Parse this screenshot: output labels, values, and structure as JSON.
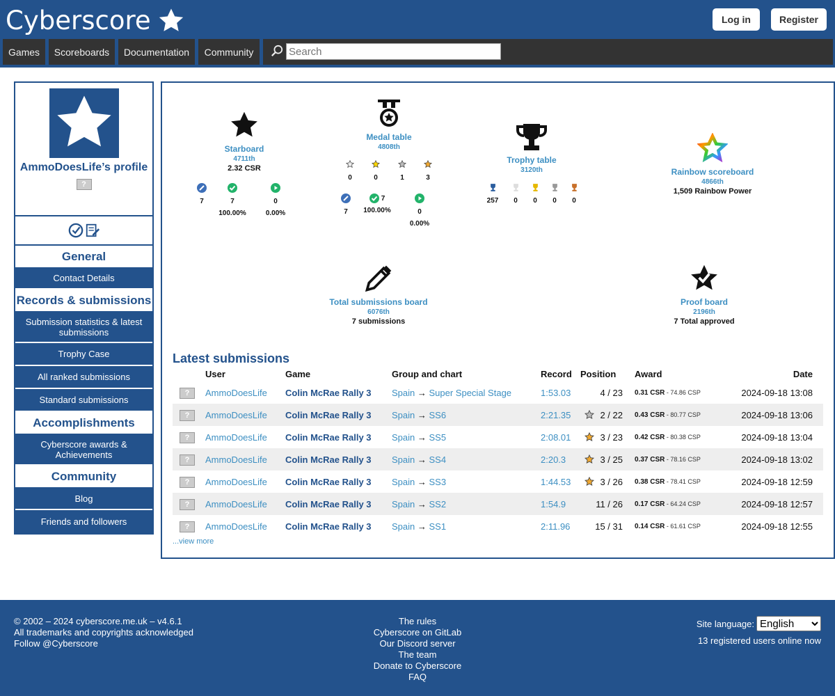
{
  "brand": {
    "name": "Cyberscore"
  },
  "header": {
    "login": "Log in",
    "register": "Register"
  },
  "nav": {
    "items": [
      "Games",
      "Scoreboards",
      "Documentation",
      "Community"
    ],
    "search_placeholder": "Search"
  },
  "sidebar": {
    "profile_name": "AmmoDoesLife’s profile",
    "badge": "?",
    "sections": [
      {
        "heading": "General",
        "links": [
          "Contact Details"
        ]
      },
      {
        "heading": "Records & submissions",
        "links": [
          "Submission statistics & latest submissions",
          "Trophy Case",
          "All ranked submissions",
          "Standard submissions"
        ]
      },
      {
        "heading": "Accomplishments",
        "links": [
          "Cyberscore awards & Achievements"
        ]
      },
      {
        "heading": "Community",
        "links": [
          "Blog",
          "Friends and followers"
        ]
      }
    ]
  },
  "boards": {
    "starboard": {
      "title": "Starboard",
      "rank": "4711th",
      "value": "2.32 CSR",
      "stats": [
        "7",
        "7",
        "0"
      ],
      "pcts": [
        "100.00%",
        "0.00%"
      ]
    },
    "medal": {
      "title": "Medal table",
      "rank": "4808th",
      "medals": [
        "0",
        "0",
        "1",
        "3"
      ],
      "stats": [
        "7",
        "7",
        "0"
      ],
      "pcts": [
        "100.00%",
        "0.00%"
      ]
    },
    "trophy": {
      "title": "Trophy table",
      "rank": "3120th",
      "values": [
        "257",
        "0",
        "0",
        "0",
        "0"
      ]
    },
    "rainbow": {
      "title": "Rainbow scoreboard",
      "rank": "4866th",
      "value": "1,509 Rainbow Power"
    },
    "total": {
      "title": "Total submissions board",
      "rank": "6076th",
      "value": "7 submissions"
    },
    "proof": {
      "title": "Proof board",
      "rank": "2196th",
      "value": "7 Total approved"
    }
  },
  "latest": {
    "heading": "Latest submissions",
    "columns": [
      "User",
      "Game",
      "Group and chart",
      "Record",
      "Position",
      "Award",
      "Date"
    ],
    "rows": [
      {
        "user": "AmmoDoesLife",
        "game": "Colin McRae Rally 3",
        "group": "Spain",
        "chart": "Super Special Stage",
        "record": "1:53.03",
        "position": "4 / 23",
        "star": "",
        "csr": "0.31 CSR",
        "csp": " - 74.86 CSP",
        "date": "2024-09-18 13:08"
      },
      {
        "user": "AmmoDoesLife",
        "game": "Colin McRae Rally 3",
        "group": "Spain",
        "chart": "SS6",
        "record": "2:21.35",
        "position": "2 / 22",
        "star": "#bbbbbb",
        "csr": "0.43 CSR",
        "csp": " - 80.77 CSP",
        "date": "2024-09-18 13:06"
      },
      {
        "user": "AmmoDoesLife",
        "game": "Colin McRae Rally 3",
        "group": "Spain",
        "chart": "SS5",
        "record": "2:08.01",
        "position": "3 / 23",
        "star": "#f0a830",
        "csr": "0.42 CSR",
        "csp": " - 80.38 CSP",
        "date": "2024-09-18 13:04"
      },
      {
        "user": "AmmoDoesLife",
        "game": "Colin McRae Rally 3",
        "group": "Spain",
        "chart": "SS4",
        "record": "2:20.3",
        "position": "3 / 25",
        "star": "#f0a830",
        "csr": "0.37 CSR",
        "csp": " - 78.16 CSP",
        "date": "2024-09-18 13:02"
      },
      {
        "user": "AmmoDoesLife",
        "game": "Colin McRae Rally 3",
        "group": "Spain",
        "chart": "SS3",
        "record": "1:44.53",
        "position": "3 / 26",
        "star": "#f0a830",
        "csr": "0.38 CSR",
        "csp": " - 78.41 CSP",
        "date": "2024-09-18 12:59"
      },
      {
        "user": "AmmoDoesLife",
        "game": "Colin McRae Rally 3",
        "group": "Spain",
        "chart": "SS2",
        "record": "1:54.9",
        "position": "11 / 26",
        "star": "",
        "csr": "0.17 CSR",
        "csp": " - 64.24 CSP",
        "date": "2024-09-18 12:57"
      },
      {
        "user": "AmmoDoesLife",
        "game": "Colin McRae Rally 3",
        "group": "Spain",
        "chart": "SS1",
        "record": "2:11.96",
        "position": "15 / 31",
        "star": "",
        "csr": "0.14 CSR",
        "csp": " - 61.61 CSP",
        "date": "2024-09-18 12:55"
      }
    ],
    "arrow": "→",
    "view_more": "...view more"
  },
  "footer": {
    "left": [
      "© 2002 – 2024 cyberscore.me.uk – v4.6.1",
      "All trademarks and copyrights acknowledged",
      "Follow @Cyberscore"
    ],
    "center": [
      "The rules",
      "Cyberscore on GitLab",
      "Our Discord server",
      "The team",
      "Donate to Cyberscore",
      "FAQ"
    ],
    "lang_label": "Site language:",
    "lang_value": "English",
    "online": "13 registered users online now"
  },
  "colors": {
    "brand": "#23528c",
    "link": "#3d8fc2",
    "nav": "#333333"
  }
}
